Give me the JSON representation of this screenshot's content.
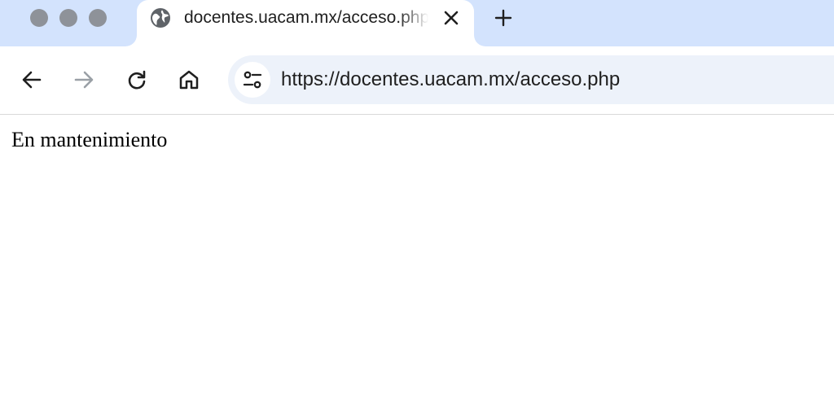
{
  "browser": {
    "window_controls": [
      "close",
      "minimize",
      "zoom"
    ],
    "tab": {
      "title": "docentes.uacam.mx/acceso.php",
      "favicon": "globe-icon",
      "close_icon": "close-icon"
    },
    "new_tab_icon": "plus-icon",
    "toolbar": {
      "back_icon": "arrow-left-icon",
      "forward_icon": "arrow-right-icon",
      "reload_icon": "reload-icon",
      "home_icon": "home-icon"
    },
    "omnibox": {
      "site_info_icon": "tune-icon",
      "url": "https://docentes.uacam.mx/acceso.php"
    }
  },
  "page": {
    "message": "En mantenimiento"
  },
  "colors": {
    "tabstrip_bg": "#d3e3fd",
    "omnibox_bg": "#edf2fa",
    "traffic_light": "#8e9299",
    "icon": "#1f1f1f",
    "icon_disabled": "#9aa0a6"
  }
}
